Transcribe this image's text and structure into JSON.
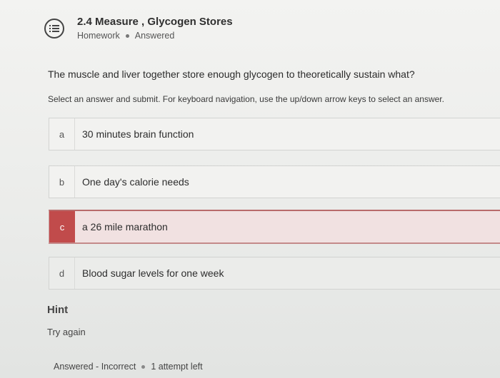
{
  "header": {
    "icon": "list-icon",
    "title": "2.4 Measure , Glycogen Stores",
    "type": "Homework",
    "state": "Answered"
  },
  "question": {
    "text": "The muscle and liver together store enough glycogen to theoretically sustain what?",
    "instructions": "Select an answer and submit. For keyboard navigation, use the up/down arrow keys to select an answer."
  },
  "choices": [
    {
      "letter": "a",
      "text": "30 minutes brain function"
    },
    {
      "letter": "b",
      "text": "One day's calorie needs"
    },
    {
      "letter": "c",
      "text": "a 26 mile marathon",
      "selected": true,
      "status_color": "#c14b4b"
    },
    {
      "letter": "d",
      "text": "Blood sugar levels for one week"
    }
  ],
  "hint": {
    "label": "Hint",
    "text": "Try again"
  },
  "status": {
    "result": "Answered - Incorrect",
    "attempts": "1 attempt left"
  }
}
